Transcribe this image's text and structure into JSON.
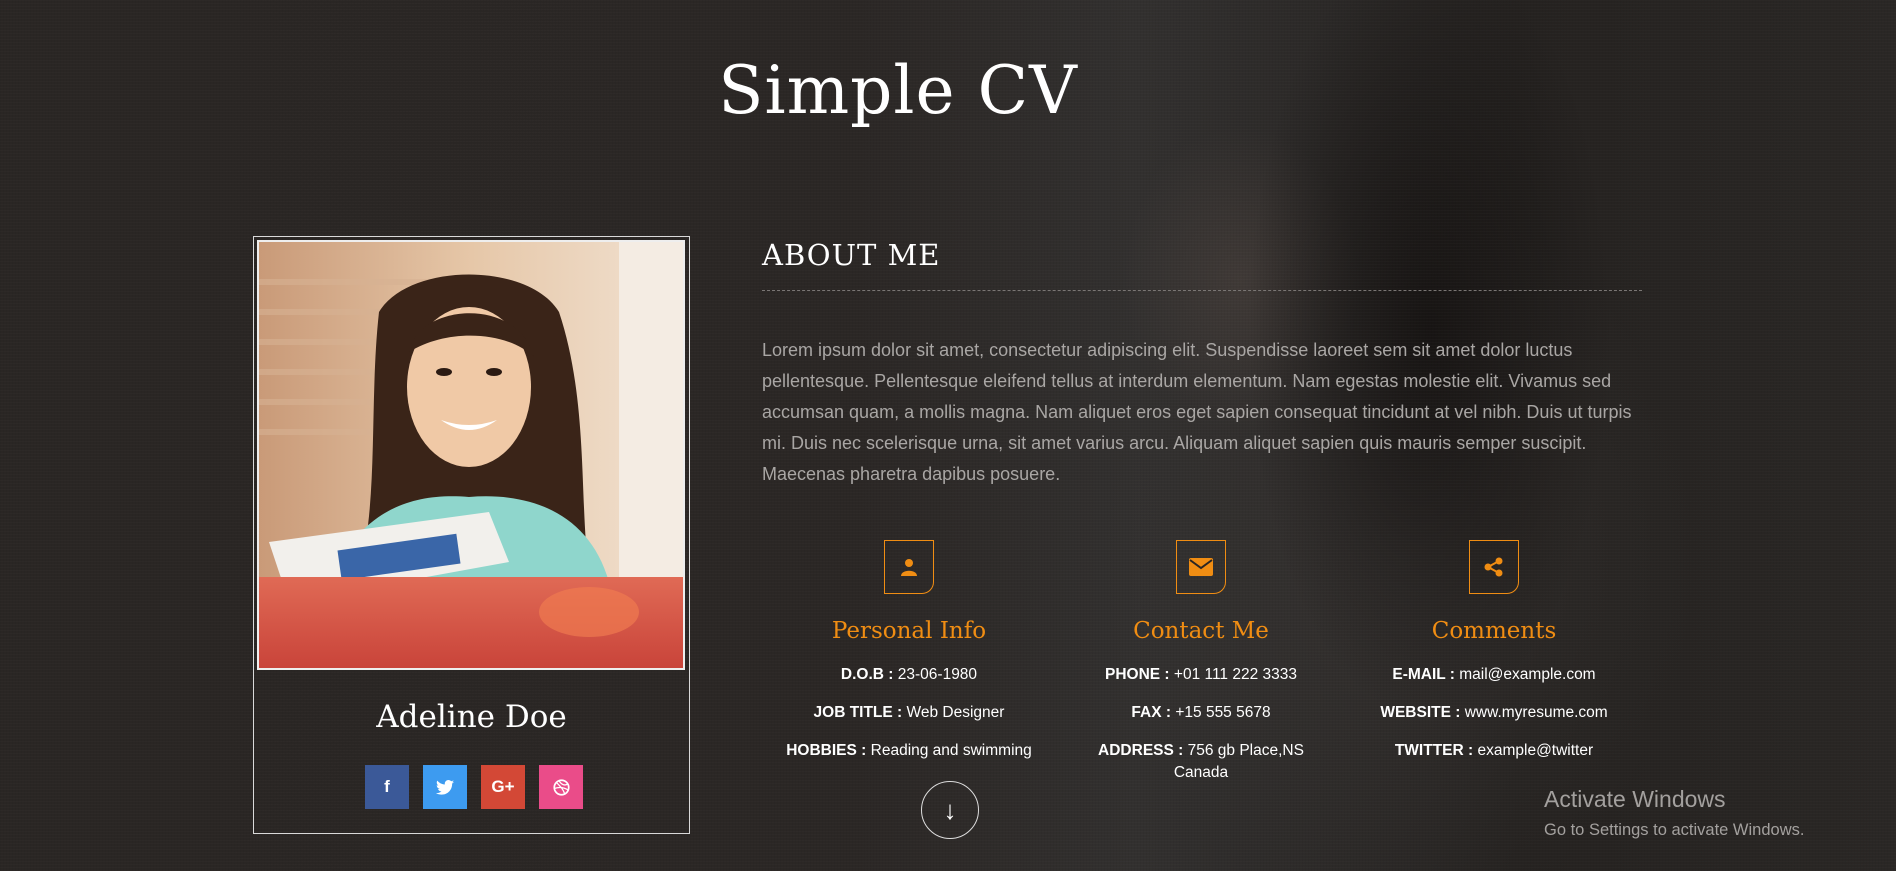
{
  "site": {
    "title": "Simple CV"
  },
  "profile": {
    "name": "Adeline Doe"
  },
  "social": [
    {
      "icon": "facebook-icon",
      "glyph": "f",
      "color": "#3b5998"
    },
    {
      "icon": "twitter-icon",
      "glyph": "🐦",
      "color": "#3d9bf0"
    },
    {
      "icon": "google-plus-icon",
      "glyph": "G+",
      "color": "#d34836"
    },
    {
      "icon": "dribbble-icon",
      "glyph": "◎",
      "color": "#ea4c89"
    }
  ],
  "about": {
    "heading": "ABOUT ME",
    "text": "Lorem ipsum dolor sit amet, consectetur adipiscing elit. Suspendisse laoreet sem sit amet dolor luctus pellentesque. Pellentesque eleifend tellus at interdum elementum. Nam egestas molestie elit. Vivamus sed accumsan quam, a mollis magna. Nam aliquet eros eget sapien consequat tincidunt at vel nibh. Duis ut turpis mi. Duis nec scelerisque urna, sit amet varius arcu. Aliquam aliquet sapien quis mauris semper suscipit. Maecenas pharetra dapibus posuere."
  },
  "accent": "#f08d13",
  "personal": {
    "heading": "Personal Info",
    "dob_label": "D.O.B :",
    "dob": "23-06-1980",
    "job_label": "JOB TITLE :",
    "job": "Web Designer",
    "hobbies_label": "HOBBIES :",
    "hobbies": "Reading and swimming"
  },
  "contact": {
    "heading": "Contact Me",
    "phone_label": "PHONE :",
    "phone": "+01 111 222 3333",
    "fax_label": "FAX :",
    "fax": "+15 555 5678",
    "address_label": "ADDRESS :",
    "address": "756 gb Place,NS Canada"
  },
  "comments": {
    "heading": "Comments",
    "email_label": "E-MAIL :",
    "email": "mail@example.com",
    "website_label": "WEBSITE :",
    "website": "www.myresume.com",
    "twitter_label": "TWITTER :",
    "twitter": "example@twitter"
  },
  "scroll": {
    "glyph": "↓"
  },
  "windows": {
    "line1": "Activate Windows",
    "line2": "Go to Settings to activate Windows."
  }
}
